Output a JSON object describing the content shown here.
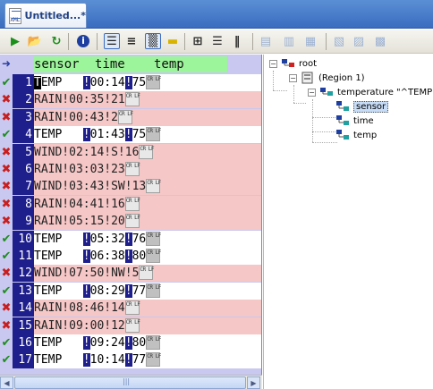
{
  "tab": {
    "title": "Untitled...*",
    "icon": "xml-file-icon",
    "icon_text": "XML"
  },
  "toolbar": {
    "buttons": [
      {
        "name": "run-icon",
        "glyph": "▶",
        "color": "#1a8f1a"
      },
      {
        "name": "open-folder-icon",
        "glyph": "📂",
        "color": "#b88a10"
      },
      {
        "name": "refresh-icon",
        "glyph": "↻",
        "color": "#1a8f1a"
      },
      {
        "name": "info-icon",
        "glyph": "i",
        "color": "#1e3fa0"
      },
      {
        "name": "numbered-list-icon",
        "glyph": "☰",
        "color": "#222"
      },
      {
        "name": "list-icon",
        "glyph": "≡",
        "color": "#222"
      },
      {
        "name": "hex-icon",
        "glyph": "▒",
        "color": "#333"
      },
      {
        "name": "ruler-icon",
        "glyph": "▬",
        "color": "#d8b400"
      },
      {
        "name": "grid-columns-icon",
        "glyph": "⊞",
        "color": "#222"
      },
      {
        "name": "rows-icon",
        "glyph": "☰",
        "color": "#222"
      },
      {
        "name": "columns-icon",
        "glyph": "‖",
        "color": "#222"
      },
      {
        "name": "table-view-icon",
        "glyph": "▤",
        "color": "#3a6cc0"
      },
      {
        "name": "form-view-icon",
        "glyph": "▥",
        "color": "#3a6cc0"
      },
      {
        "name": "split-view-icon",
        "glyph": "▦",
        "color": "#3a6cc0"
      },
      {
        "name": "tree-expand-icon",
        "glyph": "▧",
        "color": "#3a6cc0"
      },
      {
        "name": "tree-add-icon",
        "glyph": "▨",
        "color": "#3a6cc0"
      },
      {
        "name": "tree-remove-icon",
        "glyph": "▩",
        "color": "#3a6cc0"
      }
    ]
  },
  "grid": {
    "header": {
      "arrow": "➜",
      "sensor": "sensor",
      "time": "time",
      "temp": "temp"
    },
    "rows": [
      {
        "n": "1",
        "ok": true,
        "text": "TEMP",
        "cursor": true,
        "sep1": "!",
        "time": "00:14",
        "sep2": "!",
        "val": "75"
      },
      {
        "n": "2",
        "ok": false,
        "text": "RAIN!00:35!21"
      },
      {
        "n": "3",
        "ok": false,
        "text": "RAIN!00:43!2"
      },
      {
        "n": "4",
        "ok": true,
        "text": "TEMP",
        "sep1": "!",
        "time": "01:43",
        "sep2": "!",
        "val": "75"
      },
      {
        "n": "5",
        "ok": false,
        "text": "WIND!02:14!S!16"
      },
      {
        "n": "6",
        "ok": false,
        "text": "RAIN!03:03!23"
      },
      {
        "n": "7",
        "ok": false,
        "text": "WIND!03:43!SW!13"
      },
      {
        "n": "8",
        "ok": false,
        "text": "RAIN!04:41!16"
      },
      {
        "n": "9",
        "ok": false,
        "text": "RAIN!05:15!20"
      },
      {
        "n": "10",
        "ok": true,
        "text": "TEMP",
        "sep1": "!",
        "time": "05:32",
        "sep2": "!",
        "val": "76"
      },
      {
        "n": "11",
        "ok": true,
        "text": "TEMP",
        "sep1": "!",
        "time": "06:38",
        "sep2": "!",
        "val": "80"
      },
      {
        "n": "12",
        "ok": false,
        "text": "WIND!07:50!NW!5"
      },
      {
        "n": "13",
        "ok": true,
        "text": "TEMP",
        "sep1": "!",
        "time": "08:29",
        "sep2": "!",
        "val": "77"
      },
      {
        "n": "14",
        "ok": false,
        "text": "RAIN!08:46!14"
      },
      {
        "n": "15",
        "ok": false,
        "text": "RAIN!09:00!12"
      },
      {
        "n": "16",
        "ok": true,
        "text": "TEMP",
        "sep1": "!",
        "time": "09:24",
        "sep2": "!",
        "val": "80"
      },
      {
        "n": "17",
        "ok": true,
        "text": "TEMP",
        "sep1": "!",
        "time": "10:14",
        "sep2": "!",
        "val": "77"
      }
    ],
    "crlf_glyph": "CR LF",
    "colors": {
      "ok": "#1f8c1f",
      "error": "#c81e1e",
      "header_bg": "#9df59b",
      "bad_row_bg": "#f6c7c7",
      "rownum_bg": "#1e1e8c",
      "panel_bg": "#c8c8f0"
    }
  },
  "scrollbar": {
    "left": "◀",
    "right": "▶",
    "grip": "|||"
  },
  "tree": {
    "root": "root",
    "region": "(Region 1)",
    "element": "temperature \"^TEMP\"",
    "children": [
      "sensor",
      "time",
      "temp"
    ],
    "selected": "sensor",
    "expander": "−"
  }
}
